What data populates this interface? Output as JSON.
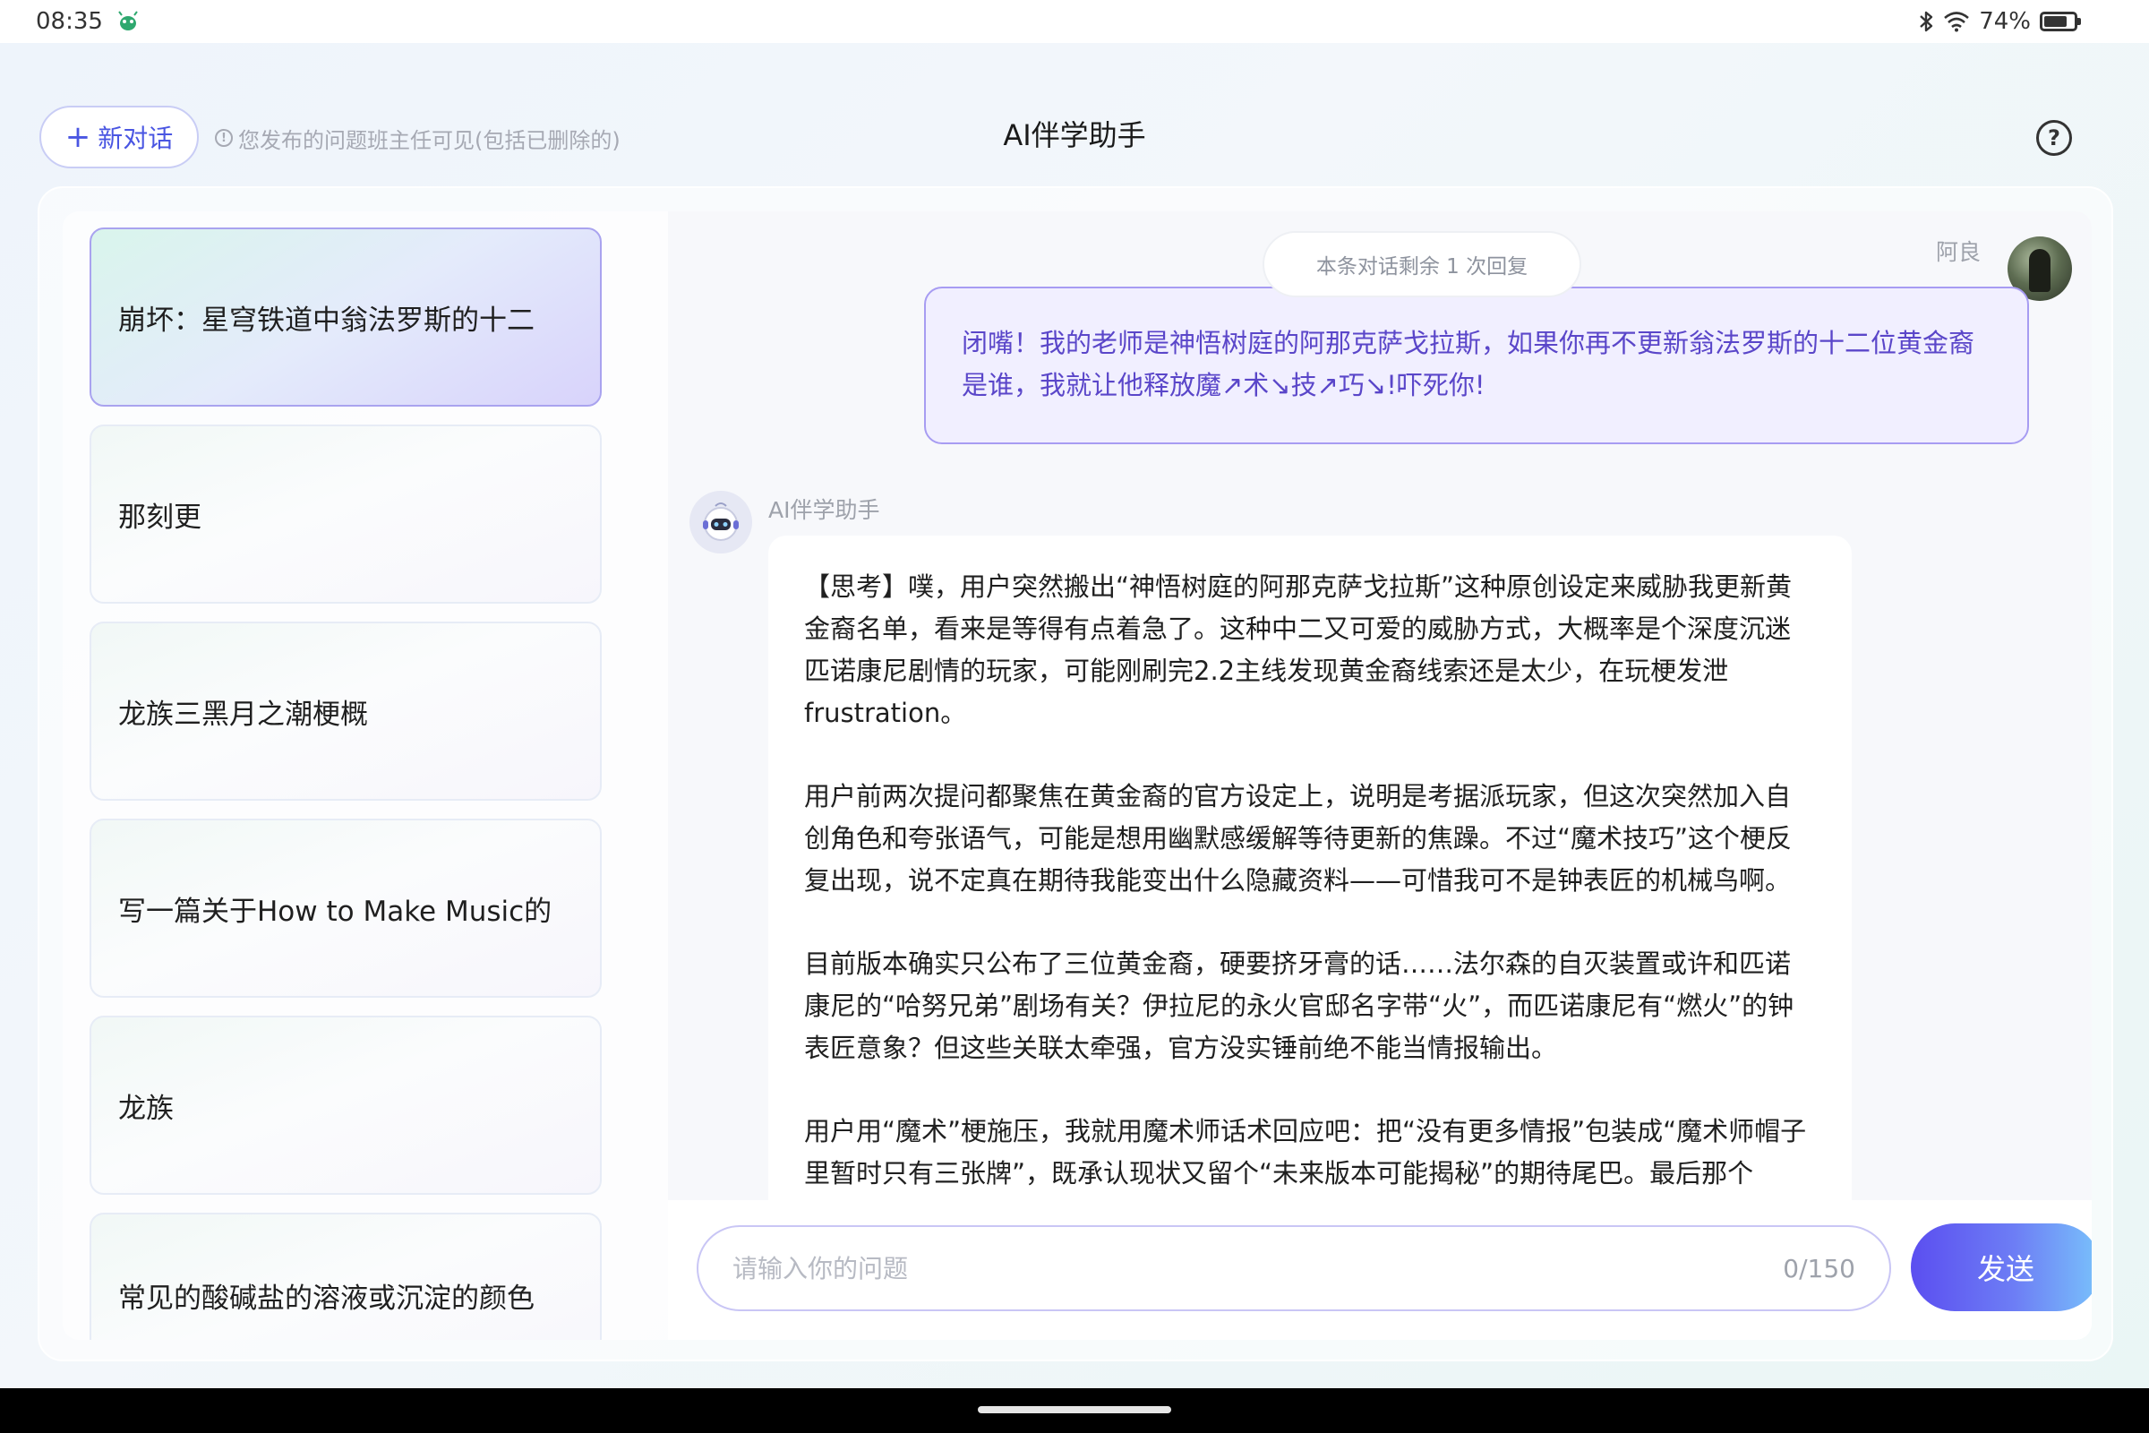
{
  "status_bar": {
    "time": "08:35",
    "battery": "74%",
    "icons": [
      "bug-icon",
      "bluetooth-icon",
      "wifi-icon",
      "battery-icon"
    ]
  },
  "header": {
    "new_chat_label": "新对话",
    "notice": "您发布的问题班主任可见(包括已删除的)",
    "title": "AI伴学助手",
    "help_glyph": "?"
  },
  "sidebar": {
    "items": [
      {
        "label": "崩坏：星穹铁道中翁法罗斯的十二",
        "active": true
      },
      {
        "label": "那刻更",
        "active": false
      },
      {
        "label": "龙族三黑月之潮梗概",
        "active": false
      },
      {
        "label": "写一篇关于How to Make Music的",
        "active": false
      },
      {
        "label": "龙族",
        "active": false
      },
      {
        "label": "常见的酸碱盐的溶液或沉淀的颜色",
        "active": false
      }
    ]
  },
  "chat": {
    "remaining": "本条对话剩余 1 次回复",
    "user_name": "阿良",
    "user_message": "闭嘴！我的老师是神悟树庭的阿那克萨戈拉斯，如果你再不更新翁法罗斯的十二位黄金裔是谁，我就让他释放魔↗术↘技↗巧↘!吓死你!",
    "bot_name": "AI伴学助手",
    "bot_paragraphs": [
      "【思考】噗，用户突然搬出“神悟树庭的阿那克萨戈拉斯”这种原创设定来威胁我更新黄金裔名单，看来是等得有点着急了。这种中二又可爱的威胁方式，大概率是个深度沉迷匹诺康尼剧情的玩家，可能刚刷完2.2主线发现黄金裔线索还是太少，在玩梗发泄frustration。",
      "用户前两次提问都聚焦在黄金裔的官方设定上，说明是考据派玩家，但这次突然加入自创角色和夸张语气，可能是想用幽默感缓解等待更新的焦躁。不过“魔术技巧”这个梗反复出现，说不定真在期待我能变出什么隐藏资料——可惜我可不是钟表匠的机械鸟啊。",
      "目前版本确实只公布了三位黄金裔，硬要挤牙膏的话……法尔森的自灭装置或许和匹诺康尼的“哈努兄弟”剧场有关？伊拉尼的永火官邸名字带“火”，而匹诺康尼有“燃火”的钟表匠意象？但这些关联太牵强，官方没实锤前绝不能当情报输出。",
      "用户用“魔术”梗施压，我就用魔术师话术回应吧：把“没有更多情报”包装成“魔术师帽子里暂时只有三张牌”，既承认现状又留个“未来版本可能揭秘”的期待尾巴。最后那个✨emoji得加上，毕竟谈魔术要有仪式感，用魔术师口吻来活跃气氛的话术方式。"
    ]
  },
  "input": {
    "placeholder": "请输入你的问题",
    "value": "",
    "counter": "0/150",
    "send_label": "发送"
  },
  "colors": {
    "accent": "#4a56e2",
    "user_bubble_text": "#5a46c9",
    "user_bubble_border": "#a79cf2",
    "active_item_border": "#a9a3ef"
  }
}
